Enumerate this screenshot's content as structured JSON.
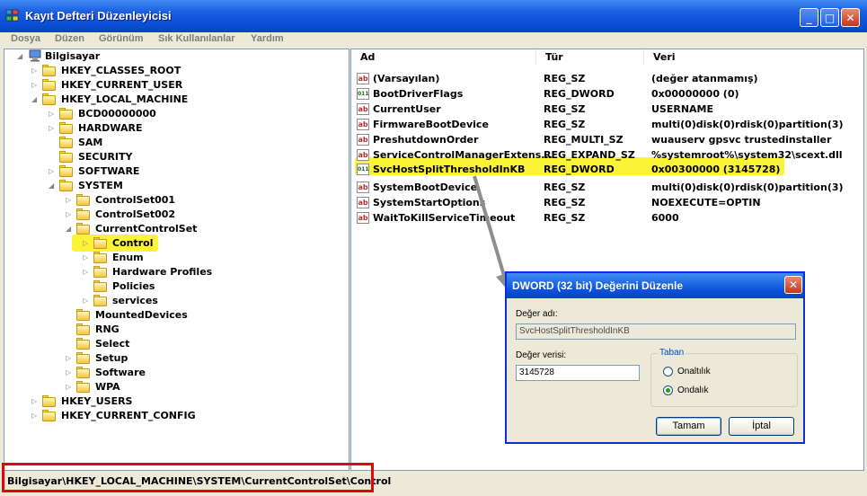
{
  "window": {
    "title": "Kayıt Defteri Düzenleyicisi",
    "min_label": "_",
    "max_label": "□",
    "close_label": "✕"
  },
  "menu": [
    "Dosya",
    "Düzen",
    "Görünüm",
    "Sık Kullanılanlar",
    "Yardım"
  ],
  "tree": {
    "root": "Bilgisayar",
    "nodes": [
      "HKEY_CLASSES_ROOT",
      "HKEY_CURRENT_USER",
      "HKEY_LOCAL_MACHINE",
      "BCD00000000",
      "HARDWARE",
      "SAM",
      "SECURITY",
      "SOFTWARE",
      "SYSTEM",
      "ControlSet001",
      "ControlSet002",
      "CurrentControlSet",
      "Control",
      "Enum",
      "Hardware Profiles",
      "Policies",
      "services",
      "MountedDevices",
      "RNG",
      "Select",
      "Setup",
      "Software",
      "WPA",
      "HKEY_USERS",
      "HKEY_CURRENT_CONFIG"
    ],
    "selected": "Control"
  },
  "list": {
    "columns": [
      "Ad",
      "Tür",
      "Veri"
    ],
    "rows": [
      {
        "name": "(Varsayılan)",
        "type": "REG_SZ",
        "data": "(değer atanmamış)",
        "icon": "string-value-icon"
      },
      {
        "name": "BootDriverFlags",
        "type": "REG_DWORD",
        "data": "0x00000000 (0)",
        "icon": "binary-value-icon"
      },
      {
        "name": "CurrentUser",
        "type": "REG_SZ",
        "data": "USERNAME",
        "icon": "string-value-icon"
      },
      {
        "name": "FirmwareBootDevice",
        "type": "REG_SZ",
        "data": "multi(0)disk(0)rdisk(0)partition(3)",
        "icon": "string-value-icon"
      },
      {
        "name": "PreshutdownOrder",
        "type": "REG_MULTI_SZ",
        "data": "wuauserv gpsvc trustedinstaller",
        "icon": "string-value-icon"
      },
      {
        "name": "ServiceControlManagerExtens...",
        "type": "REG_EXPAND_SZ",
        "data": "%systemroot%\\system32\\scext.dll",
        "icon": "string-value-icon"
      },
      {
        "name": "SvcHostSplitThresholdInKB",
        "type": "REG_DWORD",
        "data": "0x00300000 (3145728)",
        "icon": "binary-value-icon"
      },
      {
        "name": "SystemBootDevice",
        "type": "REG_SZ",
        "data": "multi(0)disk(0)rdisk(0)partition(3)",
        "icon": "string-value-icon"
      },
      {
        "name": "SystemStartOptions",
        "type": "REG_SZ",
        "data": " NOEXECUTE=OPTIN",
        "icon": "string-value-icon"
      },
      {
        "name": "WaitToKillServiceTimeout",
        "type": "REG_SZ",
        "data": "6000",
        "icon": "string-value-icon"
      }
    ],
    "highlighted_row": "SvcHostSplitThresholdInKB"
  },
  "dialog": {
    "title": "DWORD (32 bit) Değerini Düzenle",
    "name_label": "Değer adı:",
    "name_value": "SvcHostSplitThresholdInKB",
    "data_label": "Değer verisi:",
    "data_value": "3145728",
    "base_label": "Taban",
    "hex_label": "Onaltılık",
    "dec_label": "Ondalık",
    "selected_base": "Ondalık",
    "ok_label": "Tamam",
    "cancel_label": "İptal"
  },
  "status": {
    "path": "Bilgisayar\\HKEY_LOCAL_MACHINE\\SYSTEM\\CurrentControlSet\\Control"
  },
  "colors": {
    "highlight": "#fbf436",
    "status_box": "#e2050c",
    "title_blue": "#0a50d8"
  }
}
